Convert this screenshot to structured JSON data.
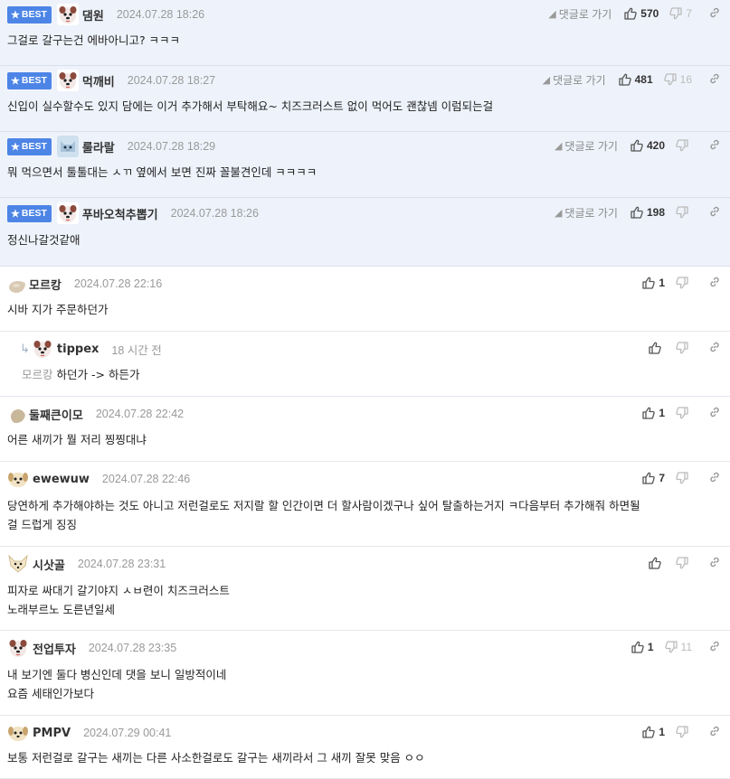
{
  "best_label": "BEST",
  "reply_link_label": "댓글로 가기",
  "comments": [
    {
      "best": true,
      "nick": "댐원",
      "date": "2024.07.28 18:26",
      "up": "570",
      "down": "7",
      "text": [
        "그걸로 갈구는건 에바아니고? ㅋㅋㅋ"
      ],
      "avatar": "dog-avatar"
    },
    {
      "best": true,
      "nick": "먹깨비",
      "date": "2024.07.28 18:27",
      "up": "481",
      "down": "16",
      "text": [
        "신입이 실수할수도 있지 담에는 이거 추가해서 부탁해요~ 치즈크러스트 없이 먹어도 괜찮넴 이럼되는걸"
      ],
      "avatar": "dog-avatar"
    },
    {
      "best": true,
      "nick": "룰라랄",
      "date": "2024.07.28 18:29",
      "up": "420",
      "down": "",
      "text": [
        "뭐 먹으면서 툴툴대는 ㅅㄲ 옆에서 보면 진짜 꼴불견인데 ㅋㅋㅋㅋ"
      ],
      "avatar": "cat-avatar"
    },
    {
      "best": true,
      "nick": "푸바오척추뽑기",
      "date": "2024.07.28 18:26",
      "up": "198",
      "down": "",
      "text": [
        "정신나갈것같애"
      ],
      "avatar": "dog-avatar"
    },
    {
      "best": false,
      "nick": "모르캉",
      "date": "2024.07.28 22:16",
      "up": "1",
      "down": "",
      "text": [
        "시바 지가 주문하던가"
      ],
      "avatar": "blob-avatar"
    },
    {
      "best": false,
      "reply": true,
      "nick": "tippex",
      "date": "18 시간 전",
      "up": "",
      "down": "",
      "mention": "모르캉",
      "text": [
        "하던가 -> 하든가"
      ],
      "avatar": "dog-avatar"
    },
    {
      "best": false,
      "nick": "둘째큰이모",
      "date": "2024.07.28 22:42",
      "up": "1",
      "down": "",
      "text": [
        "어른 새끼가 뭘 저리 찡찡대냐"
      ],
      "avatar": "dot-avatar"
    },
    {
      "best": false,
      "nick": "ewewuw",
      "date": "2024.07.28 22:46",
      "up": "7",
      "down": "",
      "text": [
        "당연하게 추가해야하는 것도 아니고 저런걸로도 저지랄 할 인간이면 더 할사람이겠구나 싶어 탈출하는거지 ㅋ다음부터 추가해줘 하면될",
        "걸 드럽게 징징"
      ],
      "avatar": "puppy-avatar"
    },
    {
      "best": false,
      "nick": "시삿골",
      "date": "2024.07.28 23:31",
      "up": "",
      "down": "",
      "text": [
        "피자로 싸대기 갈기야지 ㅅㅂ련이 치즈크러스트",
        "노래부르노 도른년일세"
      ],
      "avatar": "fox-avatar"
    },
    {
      "best": false,
      "nick": "전업투자",
      "date": "2024.07.28 23:35",
      "up": "1",
      "down": "11",
      "text": [
        "내 보기엔 둘다 병신인데 댓을 보니 일방적이네",
        "요즘 세태인가보다"
      ],
      "avatar": "dog-avatar"
    },
    {
      "best": false,
      "nick": "PMPV",
      "date": "2024.07.29 00:41",
      "up": "1",
      "down": "",
      "text": [
        "보통 저런걸로 갈구는 새끼는 다른 사소한걸로도 갈구는 새끼라서 그 새끼 잘못 맞음 ㅇㅇ"
      ],
      "avatar": "puppy-avatar"
    }
  ]
}
